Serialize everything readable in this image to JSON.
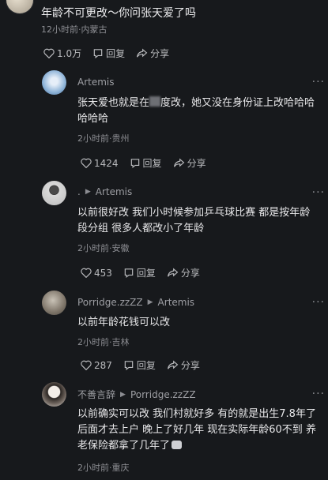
{
  "top_comment": {
    "text": "年龄不可更改～你问张天爱了吗",
    "meta": "12小时前·内蒙古",
    "likes": "1.0万",
    "reply_label": "回复",
    "share_label": "分享"
  },
  "replies": [
    {
      "author": "Artemis",
      "reply_to": "",
      "text_before": "张天爱也就是在",
      "text_after": "度改，她又没在身份证上改哈哈哈哈哈哈",
      "meta": "2小时前·贵州",
      "likes": "1424",
      "reply_label": "回复",
      "share_label": "分享"
    },
    {
      "author": ".",
      "reply_to": "Artemis",
      "text": "以前很好改 我们小时候参加乒乓球比赛 都是按年龄段分组 很多人都改小了年龄",
      "meta": "2小时前·安徽",
      "likes": "453",
      "reply_label": "回复",
      "share_label": "分享"
    },
    {
      "author": "Porridge.zzZZ",
      "reply_to": "Artemis",
      "text": "以前年龄花钱可以改",
      "meta": "2小时前·吉林",
      "likes": "287",
      "reply_label": "回复",
      "share_label": "分享"
    },
    {
      "author": "不善言辞",
      "reply_to": "Porridge.zzZZ",
      "text": "以前确实可以改 我们村就好多 有的就是出生7.8年了后面才去上户 晚上了好几年 现在实际年龄60不到 养老保险都拿了几年了",
      "meta": "2小时前·重庆"
    }
  ]
}
